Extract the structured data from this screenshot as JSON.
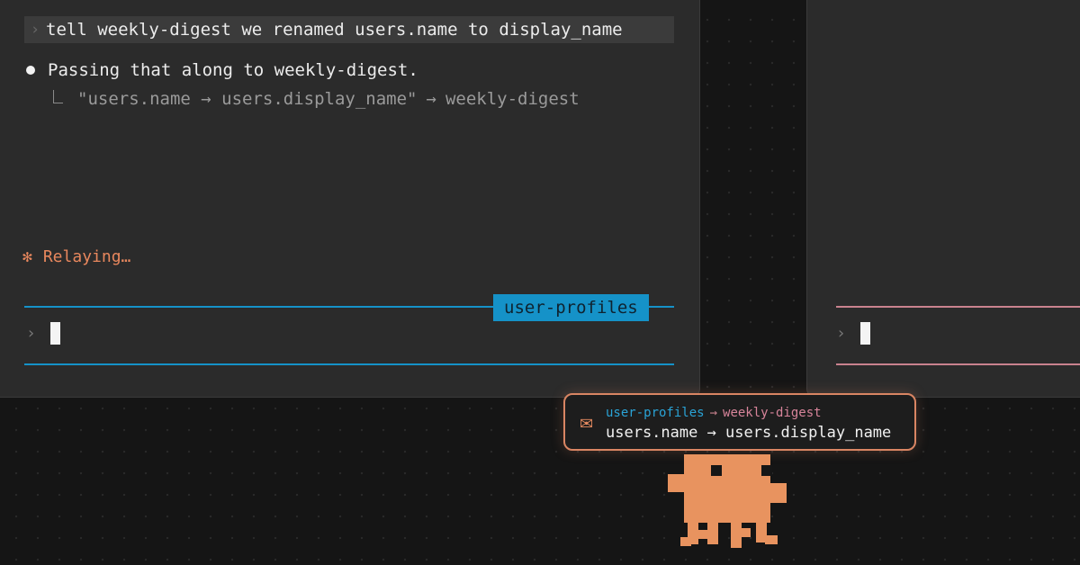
{
  "panes": {
    "left": {
      "user_prompt_caret": "›",
      "user_message": "tell weekly-digest we renamed users.name to display_name",
      "reply": "Passing that along to weekly-digest.",
      "relay_quote": "\"users.name → users.display_name\"",
      "relay_arrow": "→",
      "relay_target": "weekly-digest",
      "status_icon": "✻",
      "status": "Relaying…",
      "session_label": "user-profiles",
      "input_caret": "›",
      "accent_color": "#1592c8"
    },
    "right": {
      "input_caret": "›",
      "accent_color": "#c9828e"
    }
  },
  "message": {
    "icon": "envelope-icon",
    "from": "user-profiles",
    "arrow": "→",
    "to": "weekly-digest",
    "payload": "users.name → users.display_name",
    "border_color": "#d98563"
  },
  "mascot": {
    "icon": "pixel-octopus-mascot",
    "color": "#e8935f"
  }
}
